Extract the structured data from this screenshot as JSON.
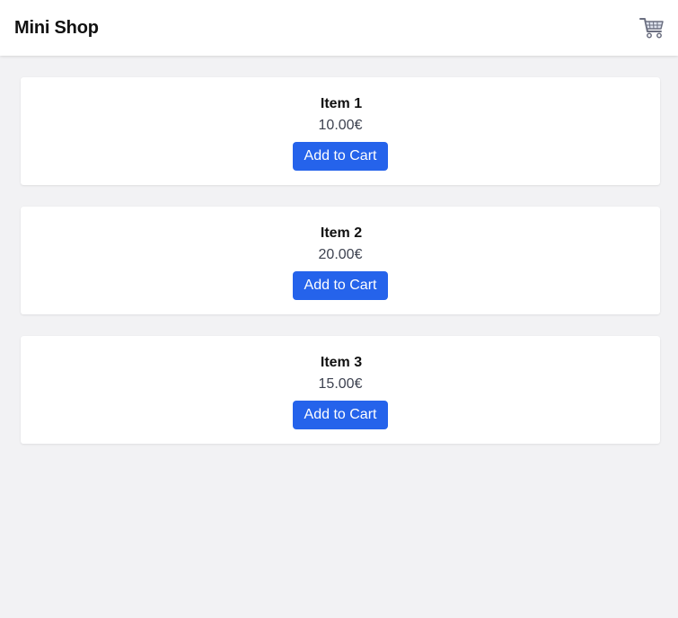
{
  "header": {
    "title": "Mini Shop",
    "cart_icon": "shopping-cart-icon"
  },
  "colors": {
    "background": "#f2f2f4",
    "card": "#ffffff",
    "button": "#2563eb",
    "button_text": "#ffffff"
  },
  "items": [
    {
      "name": "Item 1",
      "price": "10.00€",
      "button_label": "Add to Cart"
    },
    {
      "name": "Item 2",
      "price": "20.00€",
      "button_label": "Add to Cart"
    },
    {
      "name": "Item 3",
      "price": "15.00€",
      "button_label": "Add to Cart"
    }
  ]
}
